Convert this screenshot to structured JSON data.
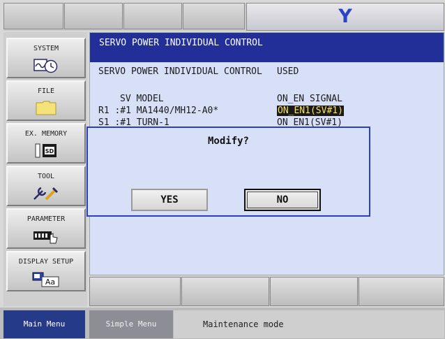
{
  "topbar": {
    "axis_indicator": "Y"
  },
  "sidemenu": {
    "items": [
      {
        "label": "SYSTEM",
        "icon": "system-clock-icon"
      },
      {
        "label": "FILE",
        "icon": "folder-icon"
      },
      {
        "label": "EX. MEMORY",
        "icon": "sd-card-icon"
      },
      {
        "label": "TOOL",
        "icon": "tool-icon"
      },
      {
        "label": "PARAMETER",
        "icon": "parameter-hand-icon"
      },
      {
        "label": "DISPLAY SETUP",
        "icon": "display-aa-icon"
      }
    ]
  },
  "content": {
    "title": "SERVO POWER INDIVIDUAL CONTROL",
    "setting_label": "SERVO POWER INDIVIDUAL CONTROL",
    "setting_value": "USED",
    "header_model": "SV MODEL",
    "header_signal": "ON_EN SIGNAL",
    "rows": [
      {
        "model": "R1 :#1 MA1440/MH12-A0*",
        "signal": "ON_EN1(SV#1)"
      },
      {
        "model": "S1 :#1 TURN-1",
        "signal": "ON_EN1(SV#1)"
      }
    ]
  },
  "dialog": {
    "message": "Modify?",
    "yes_label": "YES",
    "no_label": "NO"
  },
  "bottom": {
    "main_menu": "Main Menu",
    "simple_menu": "Simple Menu",
    "status": "Maintenance mode"
  },
  "colors": {
    "title_bar": "#232f98",
    "highlight_bg": "#1a1a1a",
    "highlight_fg": "#ffe55a",
    "axis_y": "#2a44c8"
  }
}
